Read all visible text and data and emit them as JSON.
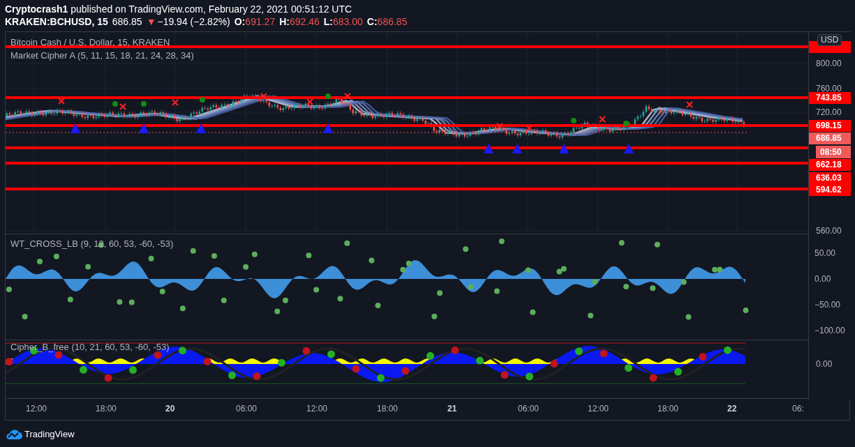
{
  "header": {
    "author": "Cryptocrash1",
    "published": "published on TradingView.com, February 22, 2021 00:51:12 UTC"
  },
  "symbol": {
    "name": "KRAKEN:BCHUSD, 15",
    "price": "686.85",
    "arrow": "▼",
    "change": "−19.94 (−2.82%)",
    "ohlc": [
      {
        "label": "O:",
        "value": "691.27"
      },
      {
        "label": "H:",
        "value": "692.46"
      },
      {
        "label": "L:",
        "value": "683.00"
      },
      {
        "label": "C:",
        "value": "686.85"
      }
    ]
  },
  "main_pane": {
    "title": "Bitcoin Cash / U.S. Dollar, 15, KRAKEN",
    "indicator": "Market Cipher A (5, 11, 15, 18, 21, 24, 28, 34)",
    "currency": "USD",
    "ticks": [
      "800.00",
      "760.00",
      "720.00",
      "560.00"
    ],
    "levels": [
      {
        "label": "743.85"
      },
      {
        "label": "698.15"
      },
      {
        "label": "662.18"
      },
      {
        "label": "636.03"
      },
      {
        "label": "594.62"
      }
    ],
    "last_price": "686.85",
    "countdown": "08:50"
  },
  "wt_pane": {
    "title": "WT_CROSS_LB (9, 12, 60, 53, -60, -53)",
    "ticks": [
      "50.00",
      "0.00",
      "−50.00",
      "−100.00"
    ]
  },
  "cipher_pane": {
    "title": "Cipher_B_free (10, 21, 60, 53, -60, -53)",
    "ticks": [
      "0.00"
    ]
  },
  "time_axis": [
    {
      "label": "12:00",
      "kind": "time"
    },
    {
      "label": "18:00",
      "kind": "time"
    },
    {
      "label": "20",
      "kind": "day"
    },
    {
      "label": "06:00",
      "kind": "time"
    },
    {
      "label": "12:00",
      "kind": "time"
    },
    {
      "label": "18:00",
      "kind": "time"
    },
    {
      "label": "21",
      "kind": "day"
    },
    {
      "label": "06:00",
      "kind": "time"
    },
    {
      "label": "12:00",
      "kind": "time"
    },
    {
      "label": "18:00",
      "kind": "time"
    },
    {
      "label": "22",
      "kind": "day"
    },
    {
      "label": "06:",
      "kind": "time"
    }
  ],
  "footer": {
    "brand": "TradingView"
  }
}
